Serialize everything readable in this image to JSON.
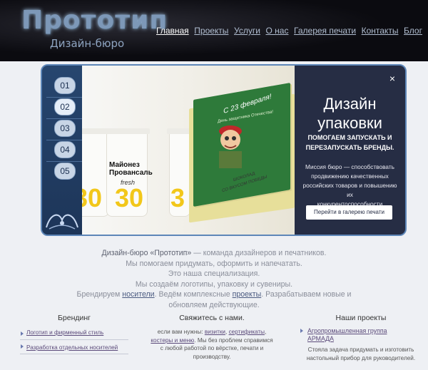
{
  "header": {
    "logo": "Прототип",
    "subtitle": "Дизайн-бюро"
  },
  "nav": [
    {
      "label": "Главная",
      "active": true
    },
    {
      "label": "Проекты"
    },
    {
      "label": "Услуги"
    },
    {
      "label": "О нас"
    },
    {
      "label": "Галерея печати"
    },
    {
      "label": "Контакты"
    },
    {
      "label": "Блог"
    }
  ],
  "slider": {
    "tabs": [
      "01",
      "02",
      "03",
      "04",
      "05"
    ],
    "selected_tab": "02",
    "title_line1": "Дизайн",
    "title_line2": "упаковки",
    "subtitle_line1": "ПОМОГАЕМ ЗАПУСКАТЬ И",
    "subtitle_line2": "ПЕРЕЗАПУСКАТЬ БРЕНДЫ.",
    "desc_lines": [
      "Миссия бюро — способствовать",
      "продвижению качественных",
      "российских товаров и повышению их",
      "конкурентоспособности"
    ],
    "button": "Перейти в галерею печати",
    "close": "×",
    "image": {
      "cup_label_line1": "Майонез",
      "cup_label_line2": "Провансаль",
      "cup_label_fresh": "fresh",
      "cup_number": "30",
      "choc_text_1": "С 23 февраля!",
      "choc_text_2": "День защитника Отечества!",
      "choc_text_3": "ШОКОЛАД",
      "choc_text_4": "СО ВКУСОМ ПОБЕДЫ"
    }
  },
  "intro": {
    "lead_brand": "Дизайн-бюро «Прототип»",
    "lead_rest": " — команда дизайнеров и печатников.",
    "line2": "Мы помогаем придумать, оформить и напечатать.",
    "line3": "Это наша специализация.",
    "line4": "Мы создаём логотипы, упаковку и сувениры.",
    "line5_pre": "Брендируем ",
    "line5_link1": "носители",
    "line5_mid": ". Ведём комплексные ",
    "line5_link2": "проекты",
    "line5_post": ". Разрабатываем новые и",
    "line6": "обновляем действующие."
  },
  "branding": {
    "title": "Брендинг",
    "items": [
      "Логотип и фирменный стиль",
      "Разработка отдельных носителей"
    ]
  },
  "contact": {
    "title": "Свяжитесь с нами.",
    "l1_pre": "если вам нужны: ",
    "link1": "визитки",
    "sep1": ", ",
    "link2": "сертификаты",
    "sep2": ",",
    "link3": "костеры и меню",
    "l2_post": ". Мы без проблем справимся",
    "l3": "с любой работой по вёрстке, печати и",
    "l4": "производству."
  },
  "projects": {
    "title": "Наши проекты",
    "link_line1": "Агропромышленная группа",
    "link_line2": "АРМАДА",
    "desc_line1": "Стояла задача придумать и изготовить",
    "desc_line2": "настольный прибор для руководителей."
  }
}
